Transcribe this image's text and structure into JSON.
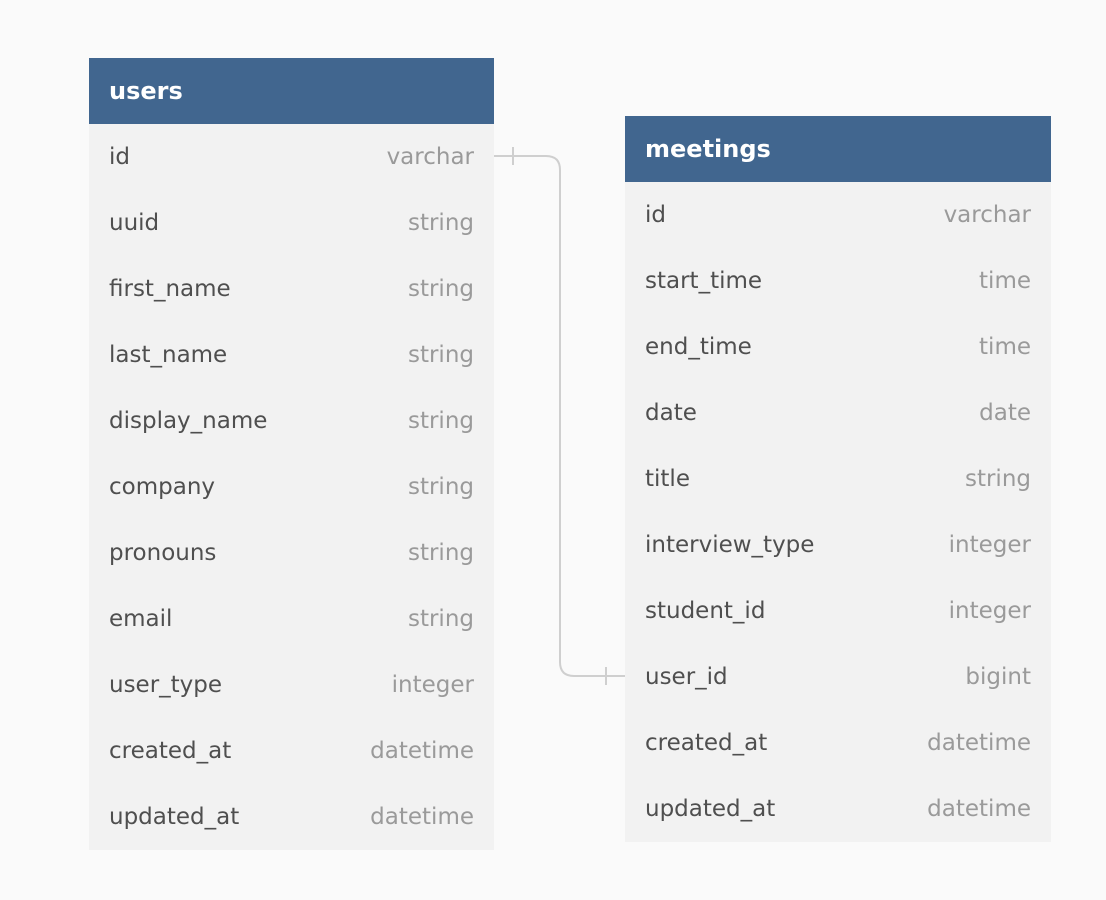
{
  "colors": {
    "header_bg": "#41668f",
    "header_text": "#ffffff",
    "body_bg": "#f2f2f2",
    "field_name": "#4f4f4f",
    "field_type": "#9a9a9a",
    "connector": "#cfcfcf",
    "page_bg": "#fafafa"
  },
  "tables": {
    "users": {
      "title": "users",
      "fields": [
        {
          "name": "id",
          "type": "varchar"
        },
        {
          "name": "uuid",
          "type": "string"
        },
        {
          "name": "first_name",
          "type": "string"
        },
        {
          "name": "last_name",
          "type": "string"
        },
        {
          "name": "display_name",
          "type": "string"
        },
        {
          "name": "company",
          "type": "string"
        },
        {
          "name": "pronouns",
          "type": "string"
        },
        {
          "name": "email",
          "type": "string"
        },
        {
          "name": "user_type",
          "type": "integer"
        },
        {
          "name": "created_at",
          "type": "datetime"
        },
        {
          "name": "updated_at",
          "type": "datetime"
        }
      ]
    },
    "meetings": {
      "title": "meetings",
      "fields": [
        {
          "name": "id",
          "type": "varchar"
        },
        {
          "name": "start_time",
          "type": "time"
        },
        {
          "name": "end_time",
          "type": "time"
        },
        {
          "name": "date",
          "type": "date"
        },
        {
          "name": "title",
          "type": "string"
        },
        {
          "name": "interview_type",
          "type": "integer"
        },
        {
          "name": "student_id",
          "type": "integer"
        },
        {
          "name": "user_id",
          "type": "bigint"
        },
        {
          "name": "created_at",
          "type": "datetime"
        },
        {
          "name": "updated_at",
          "type": "datetime"
        }
      ]
    }
  }
}
